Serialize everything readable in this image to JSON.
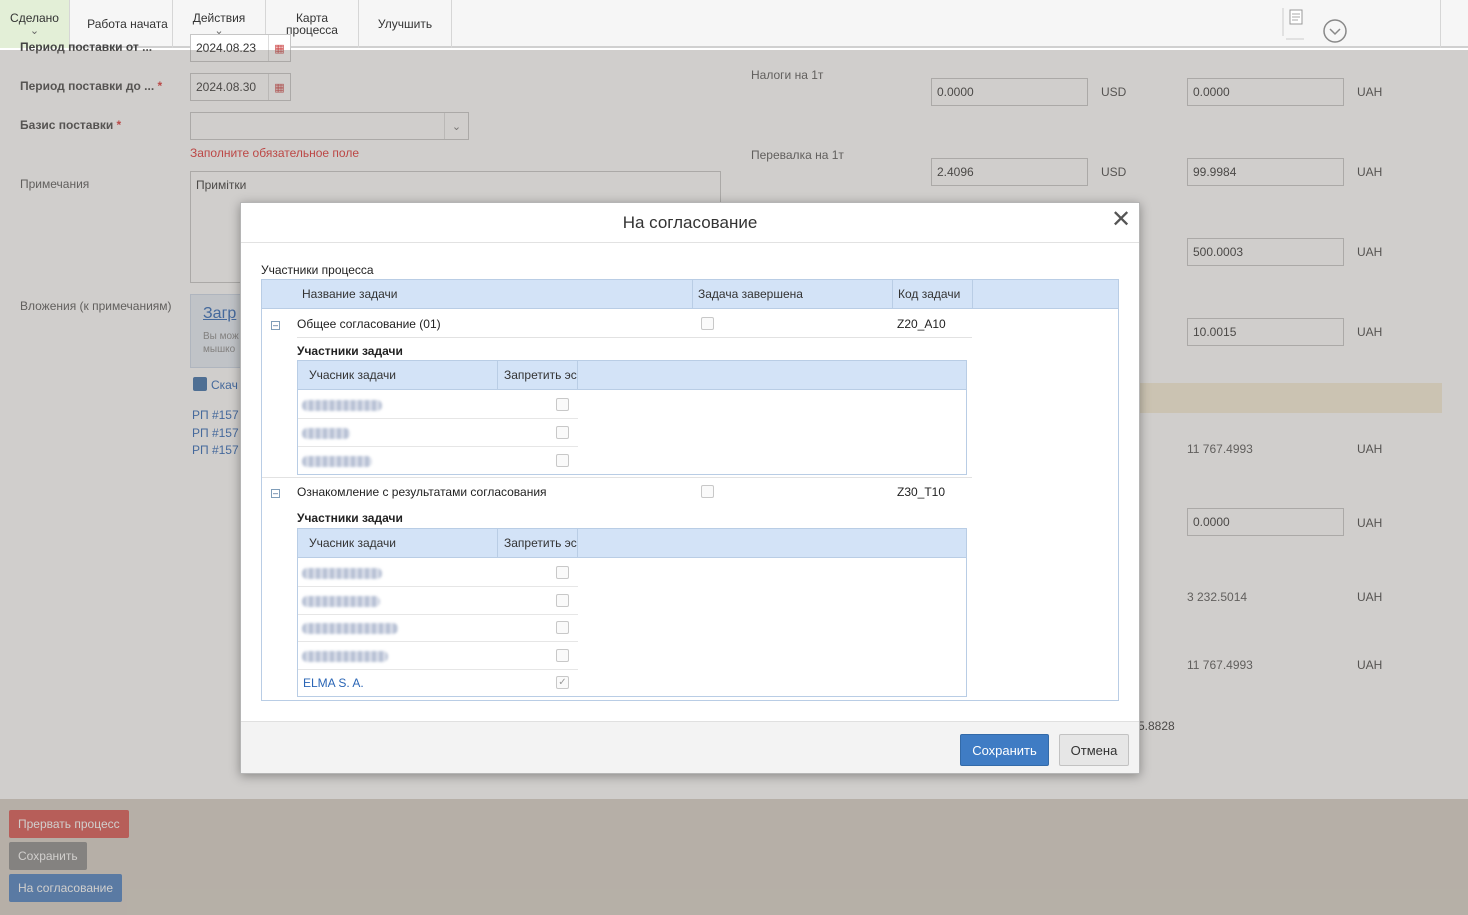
{
  "toolbar": {
    "done": "Сделано",
    "work_started": "Работа начата",
    "actions": "Действия",
    "process_map_l1": "Карта",
    "process_map_l2": "процесса",
    "improve": "Улучшить"
  },
  "form": {
    "period_from_label": "Период поставки от ...",
    "period_from_value": "2024.08.23",
    "period_to_label": "Период поставки до ...",
    "period_to_value": "2024.08.30",
    "required_mark": "*",
    "basis_label": "Базис поставки",
    "basis_value": "",
    "basis_error": "Заполните обязательное поле",
    "notes_label": "Примечания",
    "notes_value": "Примітки",
    "attachments_label": "Вложения (к примечаниям)",
    "upload_link": "Загр",
    "upload_hint_1": "Вы мож",
    "upload_hint_2": "мышко",
    "download_link": "Скач",
    "rp_links": [
      "РП #157",
      "РП #157",
      "РП #157"
    ],
    "taxes_label": "Налоги на 1т",
    "taxes_usd": "0.0000",
    "taxes_uah": "0.0000",
    "transship_label": "Перевалка на 1т",
    "transship_usd": "2.4096",
    "transship_uah": "99.9984",
    "currency_usd": "USD",
    "currency_uah": "UAH",
    "val_500": "500.0003",
    "val_10": "10.0015",
    "plain_1": "11 767.4993",
    "input_0": "0.0000",
    "plain_2": "3 232.5014",
    "plain_3": "11 767.4993",
    "partial_num": "5.8828"
  },
  "actions": {
    "abort": "Прервать процесс",
    "save": "Сохранить",
    "approve": "На согласование"
  },
  "dialog": {
    "title": "На согласование",
    "participants_label": "Участники процесса",
    "columns": {
      "task_name": "Название задачи",
      "task_done": "Задача завершена",
      "task_code": "Код задачи"
    },
    "tasks": [
      {
        "name": "Общее согласование (01)",
        "code": "Z20_A10",
        "sub_label": "Участники задачи",
        "sub_columns": {
          "participant": "Учасник задачи",
          "forbid": "Запретить эс"
        },
        "participants": [
          "",
          "",
          ""
        ]
      },
      {
        "name": "Ознакомление с результатами согласования",
        "code": "Z30_T10",
        "sub_label": "Участники задачи",
        "sub_columns": {
          "participant": "Учасник задачи",
          "forbid": "Запретить эс"
        },
        "participants": [
          "",
          "",
          "",
          "",
          "ELMA S. A."
        ]
      }
    ],
    "save_button": "Сохранить",
    "cancel_button": "Отмена"
  },
  "colors": {
    "primary": "#3f7cc4",
    "abort": "#d9534f",
    "error": "#e03030",
    "grid_header": "#d3e3f7"
  }
}
